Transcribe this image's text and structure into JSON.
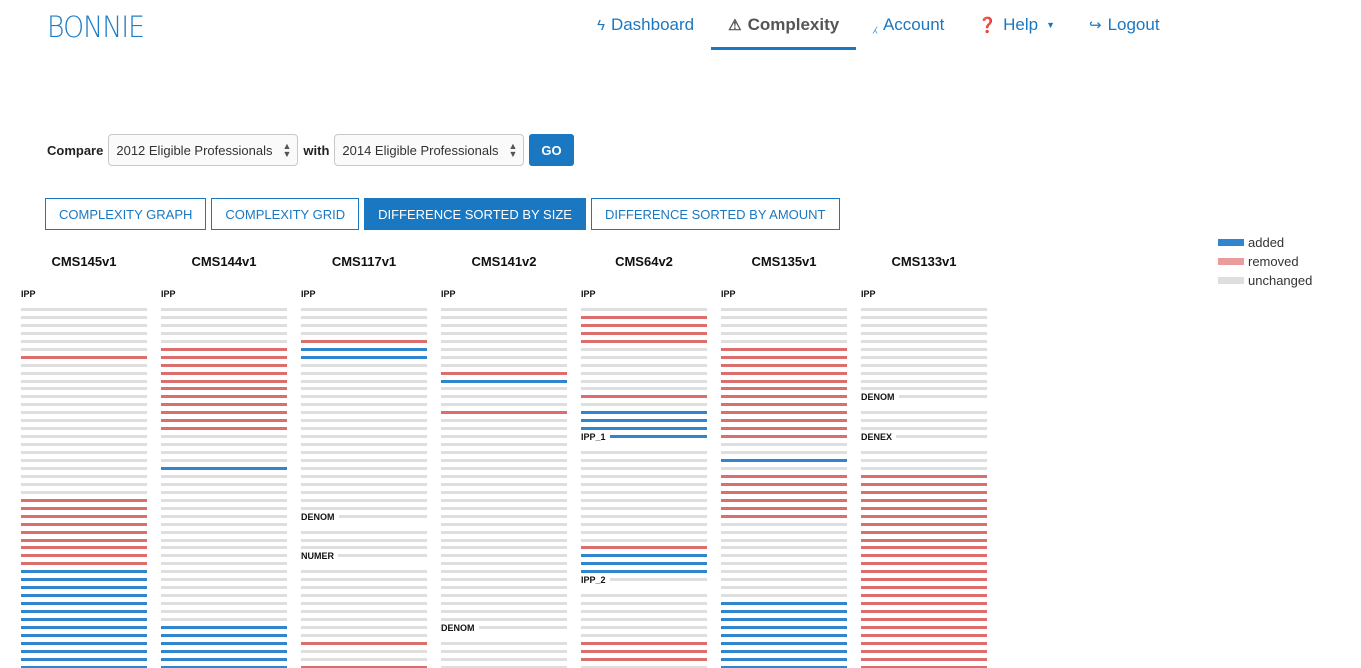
{
  "brand": "BONNIE",
  "nav": [
    {
      "label": "Dashboard",
      "icon": "bolt-icon",
      "glyph": "ϟ",
      "active": false,
      "dropdown": false
    },
    {
      "label": "Complexity",
      "icon": "warning-icon",
      "glyph": "⚠",
      "active": true,
      "dropdown": false
    },
    {
      "label": "Account",
      "icon": "magic-wand-icon",
      "glyph": "⁁",
      "active": false,
      "dropdown": false
    },
    {
      "label": "Help",
      "icon": "question-circle-icon",
      "glyph": "❓",
      "active": false,
      "dropdown": true
    },
    {
      "label": "Logout",
      "icon": "logout-icon",
      "glyph": "↪",
      "active": false,
      "dropdown": false
    }
  ],
  "compare": {
    "label": "Compare",
    "with_label": "with",
    "from_value": "2012 Eligible Professionals",
    "to_value": "2014 Eligible Professionals",
    "go_label": "GO"
  },
  "tabs": [
    {
      "label": "COMPLEXITY GRAPH",
      "active": false
    },
    {
      "label": "COMPLEXITY GRID",
      "active": false
    },
    {
      "label": "DIFFERENCE SORTED BY SIZE",
      "active": true
    },
    {
      "label": "DIFFERENCE SORTED BY AMOUNT",
      "active": false
    }
  ],
  "legend": [
    {
      "key": "a",
      "label": "added",
      "color": "#3185cf"
    },
    {
      "key": "r",
      "label": "removed",
      "color": "#ea9c9c"
    },
    {
      "key": "u",
      "label": "unchanged",
      "color": "#dedede"
    }
  ],
  "colors": {
    "added": "#3185cf",
    "removed": "#db6d6d",
    "unchanged": "#dedede",
    "accent": "#1a78c2"
  },
  "measures": [
    {
      "title": "CMS145v1",
      "labels": [
        {
          "text": "IPP",
          "row": 0
        }
      ],
      "rows": "uuuuuuuruuuuuuuuuuuuuuuuurrrrrrrrraaaaaaaaaaaaaa"
    },
    {
      "title": "CMS144v1",
      "labels": [
        {
          "text": "IPP",
          "row": 0
        }
      ],
      "rows": "uuuuuurrrrrrrrrrruuuuauuuuuuuuuuuuuuuuuuuaaaaaaa"
    },
    {
      "title": "CMS117v1",
      "labels": [
        {
          "text": "IPP",
          "row": 0
        },
        {
          "text": "DENOM",
          "row": 28
        },
        {
          "text": "NUMER",
          "row": 33
        }
      ],
      "rows": "uuuuuraauuuuuuuuuuuuuuuuuuuuuuuuuuuuuuuuuuuruuru"
    },
    {
      "title": "CMS141v2",
      "labels": [
        {
          "text": "IPP",
          "row": 0
        },
        {
          "text": "DENOM",
          "row": 42
        }
      ],
      "rows": "uuuuuuuuurauuuruuuuuuuuuuuuuuuuuuuuuuuuuuuuuuuu"
    },
    {
      "title": "CMS64v2",
      "labels": [
        {
          "text": "IPP",
          "row": 0
        },
        {
          "text": "IPP_1",
          "row": 18
        },
        {
          "text": "IPP_2",
          "row": 36
        }
      ],
      "rows": "uurrrruuuuuuruaaaauuuuuuuuuuuuuraaauuuuuuuurrruu"
    },
    {
      "title": "CMS135v1",
      "labels": [
        {
          "text": "IPP",
          "row": 0
        }
      ],
      "rows": "uuuuuurrrrrrrrrrrruuaurrrrrruuuuuuuuuuaaaaaaaaaa"
    },
    {
      "title": "CMS133v1",
      "labels": [
        {
          "text": "IPP",
          "row": 0
        },
        {
          "text": "DENOM",
          "row": 13
        },
        {
          "text": "DENEX",
          "row": 18
        }
      ],
      "rows": "uuuuuuuuuuuuuuuuuuuuuurrrrrrrrrrrrrrrrrrrrrrrrr"
    }
  ]
}
